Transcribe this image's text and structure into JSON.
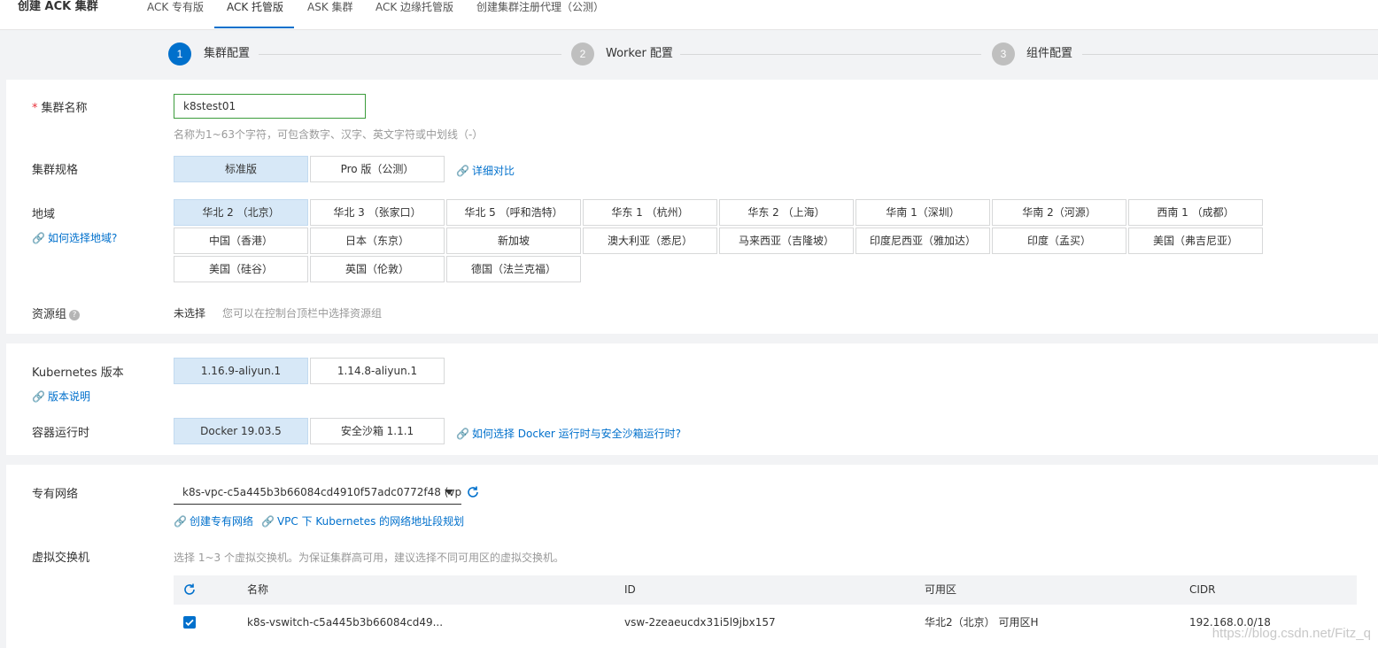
{
  "header": {
    "title": "创建 ACK 集群",
    "tabs": [
      "ACK 专有版",
      "ACK 托管版",
      "ASK 集群",
      "ACK 边缘托管版",
      "创建集群注册代理（公测）"
    ],
    "active_tab": "ACK 托管版"
  },
  "steps": [
    {
      "num": "1",
      "label": "集群配置"
    },
    {
      "num": "2",
      "label": "Worker 配置"
    },
    {
      "num": "3",
      "label": "组件配置"
    }
  ],
  "basic": {
    "cluster_name_label": "集群名称",
    "required_mark": "*",
    "cluster_name_value": "k8stest01",
    "cluster_name_hint": "名称为1~63个字符，可包含数字、汉字、英文字符或中划线（-）",
    "spec_label": "集群规格",
    "spec_options": [
      "标准版",
      "Pro 版（公测）"
    ],
    "spec_selected": "标准版",
    "spec_compare_link": "详细对比",
    "region_label": "地域",
    "region_help_link": "如何选择地域?",
    "regions": [
      "华北 2 （北京）",
      "华北 3 （张家口）",
      "华北 5 （呼和浩特）",
      "华东 1 （杭州）",
      "华东 2 （上海）",
      "华南 1（深圳）",
      "华南 2（河源）",
      "西南 1 （成都）",
      "中国（香港）",
      "日本（东京）",
      "新加坡",
      "澳大利亚（悉尼）",
      "马来西亚（吉隆坡）",
      "印度尼西亚（雅加达）",
      "印度（孟买）",
      "美国（弗吉尼亚）",
      "美国（硅谷）",
      "英国（伦敦）",
      "德国（法兰克福）"
    ],
    "region_selected": "华北 2 （北京）",
    "resource_group_label": "资源组",
    "resource_group_value": "未选择",
    "resource_group_hint": "您可以在控制台顶栏中选择资源组"
  },
  "kubernetes": {
    "version_label": "Kubernetes 版本",
    "version_link": "版本说明",
    "versions": [
      "1.16.9-aliyun.1",
      "1.14.8-aliyun.1"
    ],
    "version_selected": "1.16.9-aliyun.1",
    "runtime_label": "容器运行时",
    "runtimes": [
      "Docker 19.03.5",
      "安全沙箱 1.1.1"
    ],
    "runtime_selected": "Docker 19.03.5",
    "runtime_link": "如何选择 Docker 运行时与安全沙箱运行时?"
  },
  "network": {
    "vpc_label": "专有网络",
    "vpc_value": "k8s-vpc-c5a445b3b66084cd4910f57adc0772f48 (vpc-...",
    "create_vpc_link": "创建专有网络",
    "vpc_plan_link": "VPC 下 Kubernetes 的网络地址段规划",
    "vswitch_label": "虚拟交换机",
    "vswitch_hint": "选择 1~3 个虚拟交换机。为保证集群高可用，建议选择不同可用区的虚拟交换机。",
    "table": {
      "columns": [
        "名称",
        "ID",
        "可用区",
        "CIDR"
      ],
      "rows": [
        {
          "checked": true,
          "name": "k8s-vswitch-c5a445b3b66084cd49...",
          "id": "vsw-2zeaeucdx31i5l9jbx157",
          "zone": "华北2（北京） 可用区H",
          "cidr": "192.168.0.0/18"
        }
      ]
    }
  },
  "watermark": "https://blog.csdn.net/Fitz_q",
  "colors": {
    "accent": "#0070cc",
    "selected_bg": "#d7e8f7",
    "input_border": "#3b9c3b",
    "step_inactive": "#bfbfbf"
  }
}
